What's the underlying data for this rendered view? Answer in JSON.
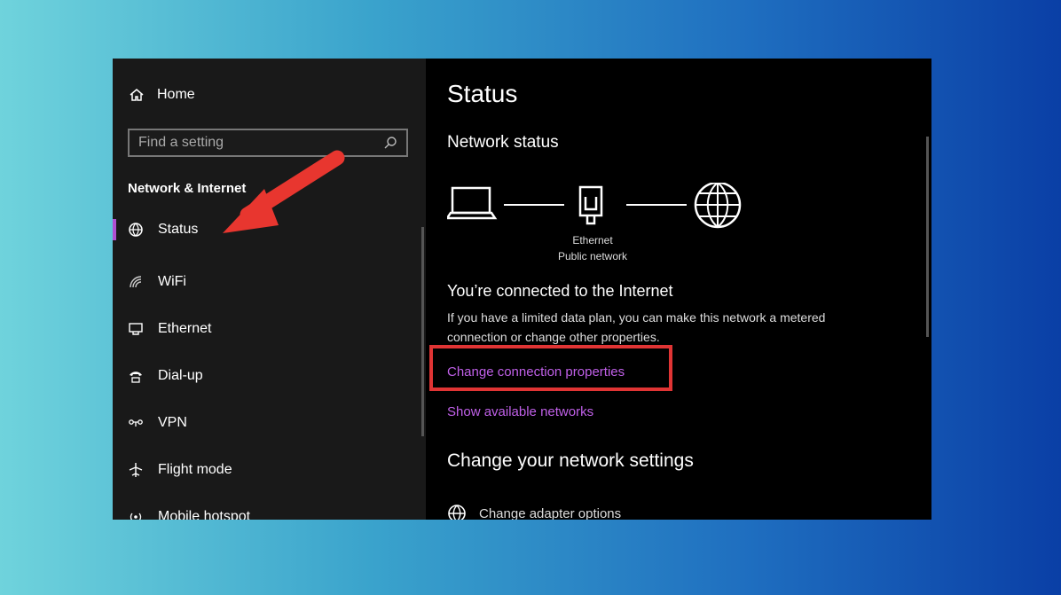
{
  "sidebar": {
    "home_label": "Home",
    "search_placeholder": "Find a setting",
    "section_title": "Network & Internet",
    "items": [
      {
        "label": "Status",
        "icon": "globe-status-icon"
      },
      {
        "label": "WiFi",
        "icon": "wifi-icon"
      },
      {
        "label": "Ethernet",
        "icon": "ethernet-icon"
      },
      {
        "label": "Dial-up",
        "icon": "phone-icon"
      },
      {
        "label": "VPN",
        "icon": "vpn-icon"
      },
      {
        "label": "Flight mode",
        "icon": "airplane-icon"
      },
      {
        "label": "Mobile hotspot",
        "icon": "hotspot-icon"
      }
    ]
  },
  "main": {
    "title": "Status",
    "network_status_heading": "Network status",
    "diagram": {
      "adapter_name": "Ethernet",
      "network_type": "Public network"
    },
    "connected_heading": "You’re connected to the Internet",
    "description": "If you have a limited data plan, you can make this network a metered connection or change other properties.",
    "change_connection_link": "Change connection properties",
    "show_networks_link": "Show available networks",
    "change_settings_heading": "Change your network settings",
    "adapter_options_label": "Change adapter options"
  },
  "colors": {
    "accent": "#c060e8",
    "highlight": "#e03434",
    "arrow": "#e8362f"
  }
}
